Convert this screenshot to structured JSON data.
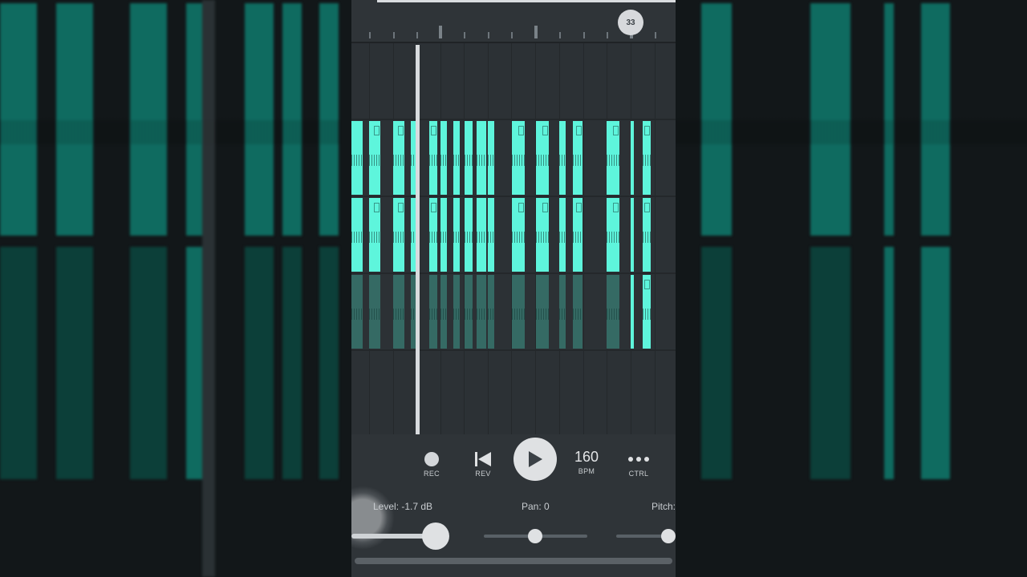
{
  "ruler": {
    "bar_marker": "33"
  },
  "transport": {
    "rec_label": "REC",
    "rev_label": "REV",
    "bpm_value": "160",
    "bpm_label": "BPM",
    "ctrl_label": "CTRL"
  },
  "params": {
    "level_label": "Level: -1.7 dB",
    "pan_label": "Pan: 0",
    "pitch_label": "Pitch:"
  },
  "colors": {
    "clip_active": "#5ef5dc",
    "clip_dim": "#356a64",
    "background": "#2b3034"
  },
  "icons": [
    "record-icon",
    "rewind-icon",
    "play-icon",
    "more-icon"
  ]
}
